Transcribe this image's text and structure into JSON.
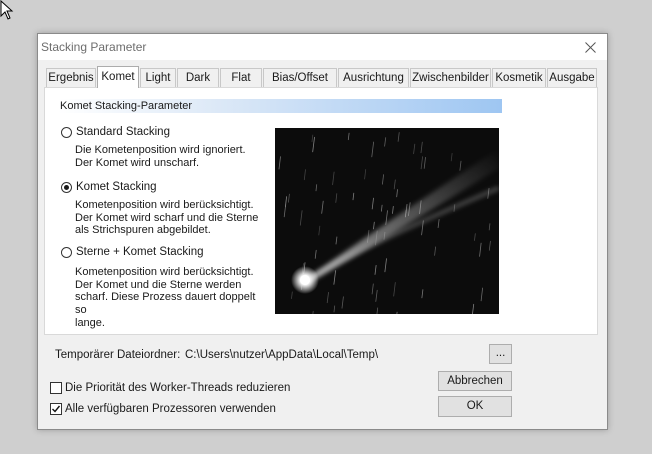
{
  "window": {
    "title": "Stacking Parameter"
  },
  "tabs": [
    {
      "label": "Ergebnis",
      "active": false
    },
    {
      "label": "Komet",
      "active": true
    },
    {
      "label": "Light",
      "active": false
    },
    {
      "label": "Dark",
      "active": false
    },
    {
      "label": "Flat",
      "active": false
    },
    {
      "label": "Bias/Offset",
      "active": false
    },
    {
      "label": "Ausrichtung",
      "active": false
    },
    {
      "label": "Zwischenbilder",
      "active": false
    },
    {
      "label": "Kosmetik",
      "active": false
    },
    {
      "label": "Ausgabe",
      "active": false
    }
  ],
  "comet": {
    "header": "Komet Stacking-Parameter",
    "options": [
      {
        "label": "Standard Stacking",
        "checked": false,
        "desc": [
          "Die Kometenposition wird ignoriert.",
          "Der Komet wird unscharf."
        ]
      },
      {
        "label": "Komet Stacking",
        "checked": true,
        "desc": [
          "Kometenposition wird berücksichtigt.",
          "Der Komet wird scharf und die Sterne",
          "als Strichspuren abgebildet."
        ]
      },
      {
        "label": "Sterne + Komet Stacking",
        "checked": false,
        "desc": [
          "Kometenposition wird berücksichtigt.",
          "Der Komet und die Sterne werden",
          "scharf. Diese Prozess dauert doppelt so",
          "lange."
        ]
      }
    ]
  },
  "temp": {
    "label": "Temporärer Dateiordner:",
    "path": "C:\\Users\\nutzer\\AppData\\Local\\Temp\\",
    "browse_label": "..."
  },
  "options": {
    "reduce_priority": {
      "label": "Die Priorität des Worker-Threads reduzieren",
      "checked": false
    },
    "use_all_cpus": {
      "label": "Alle verfügbaren Prozessoren verwenden",
      "checked": true
    }
  },
  "buttons": {
    "cancel": "Abbrechen",
    "ok": "OK"
  }
}
